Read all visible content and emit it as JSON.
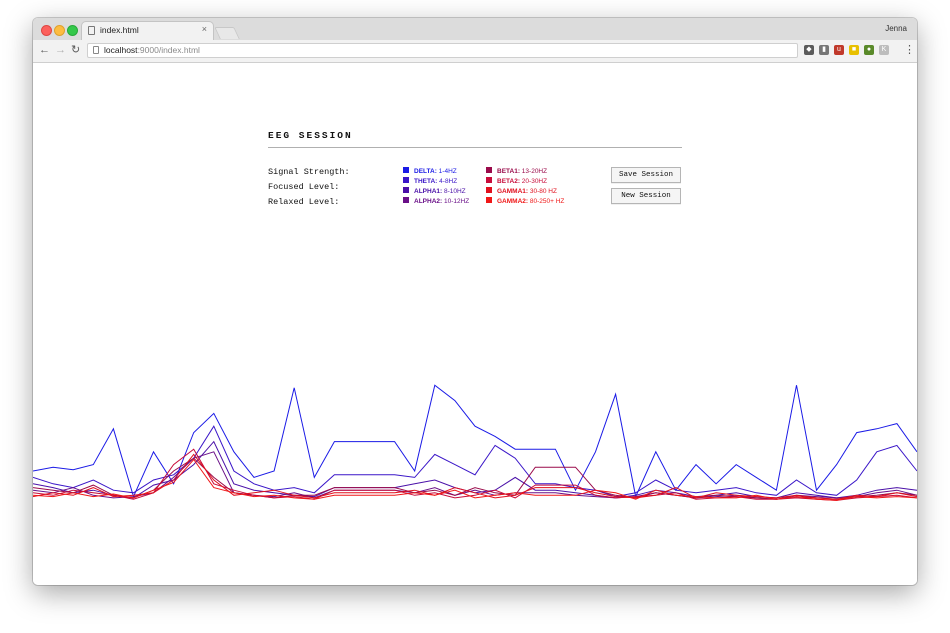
{
  "browser": {
    "tab_title": "index.html",
    "tab_close": "×",
    "profile_name": "Jenna",
    "url_host": "localhost",
    "url_path": ":9000/index.html",
    "extensions": [
      {
        "name": "evernote-icon",
        "color": "#5b5b5b",
        "glyph": "◆"
      },
      {
        "name": "bookmark-icon",
        "color": "#777777",
        "glyph": "▮"
      },
      {
        "name": "ublock-icon",
        "color": "#c0392b",
        "glyph": "u"
      },
      {
        "name": "yellow-extension-icon",
        "color": "#e8c000",
        "glyph": "■"
      },
      {
        "name": "pie-extension-icon",
        "color": "#5a8a2a",
        "glyph": "●"
      },
      {
        "name": "grey-extension-icon",
        "color": "#bdbdbd",
        "glyph": "K"
      }
    ]
  },
  "session": {
    "title": "EEG SESSION",
    "stats": [
      "Signal Strength:",
      "Focused Level:",
      "Relaxed Level:"
    ],
    "save_button": "Save Session",
    "new_button": "New Session"
  },
  "legend": [
    {
      "name": "DELTA:",
      "range": "1-4HZ",
      "color": "#1a1ae6"
    },
    {
      "name": "THETA:",
      "range": "4-8HZ",
      "color": "#3a16c8"
    },
    {
      "name": "ALPHA1:",
      "range": "8-10HZ",
      "color": "#4a10a8"
    },
    {
      "name": "ALPHA2:",
      "range": "10-12HZ",
      "color": "#6a1088"
    },
    {
      "name": "BETA1:",
      "range": "13-20HZ",
      "color": "#9a0a4a"
    },
    {
      "name": "BETA2:",
      "range": "20-30HZ",
      "color": "#c80c3a"
    },
    {
      "name": "GAMMA1:",
      "range": "30-80 HZ",
      "color": "#e0101e"
    },
    {
      "name": "GAMMA2:",
      "range": "80-250+ HZ",
      "color": "#f01818"
    }
  ],
  "chart_data": {
    "type": "line",
    "title": "",
    "xlabel": "",
    "ylabel": "",
    "grid": false,
    "legend": "none",
    "ylim": [
      0,
      100
    ],
    "x": [
      0,
      1,
      2,
      3,
      4,
      5,
      6,
      7,
      8,
      9,
      10,
      11,
      12,
      13,
      14,
      15,
      16,
      17,
      18,
      19,
      20,
      21,
      22,
      23,
      24,
      25,
      26,
      27,
      28,
      29,
      30,
      31,
      32,
      33,
      34,
      35,
      36,
      37,
      38,
      39,
      40,
      41,
      42,
      43,
      44
    ],
    "series": [
      {
        "name": "DELTA",
        "color": "#1a1ae6",
        "values": [
          25,
          28,
          26,
          30,
          58,
          5,
          40,
          15,
          55,
          70,
          40,
          20,
          25,
          90,
          20,
          48,
          48,
          48,
          48,
          25,
          92,
          80,
          60,
          52,
          42,
          42,
          42,
          10,
          40,
          85,
          5,
          40,
          10,
          30,
          15,
          30,
          20,
          10,
          92,
          10,
          30,
          55,
          58,
          62,
          40
        ]
      },
      {
        "name": "THETA",
        "color": "#3a16c8",
        "values": [
          20,
          15,
          12,
          18,
          10,
          8,
          18,
          22,
          35,
          60,
          25,
          15,
          10,
          12,
          8,
          22,
          22,
          22,
          22,
          20,
          38,
          30,
          22,
          45,
          35,
          15,
          15,
          12,
          10,
          5,
          8,
          18,
          10,
          8,
          10,
          12,
          8,
          6,
          18,
          8,
          6,
          18,
          40,
          45,
          25
        ]
      },
      {
        "name": "ALPHA1",
        "color": "#4a10a8",
        "values": [
          15,
          12,
          8,
          10,
          6,
          4,
          14,
          18,
          30,
          48,
          15,
          10,
          8,
          6,
          5,
          12,
          12,
          12,
          12,
          15,
          18,
          12,
          8,
          10,
          20,
          10,
          10,
          8,
          6,
          4,
          6,
          10,
          8,
          5,
          6,
          8,
          5,
          4,
          8,
          6,
          4,
          6,
          10,
          12,
          10
        ]
      },
      {
        "name": "ALPHA2",
        "color": "#6a1088",
        "values": [
          10,
          8,
          12,
          6,
          4,
          5,
          8,
          20,
          35,
          40,
          8,
          6,
          5,
          8,
          4,
          10,
          10,
          10,
          10,
          8,
          12,
          6,
          10,
          6,
          8,
          8,
          8,
          6,
          5,
          4,
          5,
          8,
          6,
          4,
          5,
          6,
          4,
          3,
          6,
          5,
          4,
          5,
          8,
          10,
          6
        ]
      },
      {
        "name": "BETA1",
        "color": "#9a0a4a",
        "values": [
          12,
          10,
          8,
          14,
          6,
          4,
          10,
          25,
          35,
          20,
          8,
          6,
          4,
          6,
          6,
          12,
          12,
          12,
          12,
          8,
          10,
          6,
          12,
          8,
          6,
          28,
          28,
          28,
          10,
          6,
          4,
          8,
          6,
          4,
          6,
          5,
          4,
          3,
          5,
          4,
          3,
          5,
          6,
          8,
          6
        ]
      },
      {
        "name": "BETA2",
        "color": "#c80c3a",
        "values": [
          8,
          6,
          10,
          8,
          6,
          3,
          8,
          30,
          42,
          15,
          10,
          6,
          4,
          5,
          3,
          10,
          10,
          10,
          10,
          6,
          8,
          4,
          6,
          10,
          4,
          14,
          14,
          14,
          6,
          4,
          5,
          6,
          8,
          3,
          4,
          5,
          3,
          3,
          4,
          3,
          2,
          4,
          5,
          6,
          4
        ]
      },
      {
        "name": "GAMMA1",
        "color": "#e0101e",
        "values": [
          5,
          8,
          6,
          12,
          5,
          6,
          8,
          18,
          38,
          18,
          6,
          8,
          10,
          6,
          4,
          8,
          8,
          8,
          8,
          10,
          6,
          12,
          8,
          4,
          6,
          12,
          12,
          12,
          8,
          5,
          4,
          6,
          12,
          4,
          8,
          6,
          5,
          4,
          6,
          4,
          3,
          6,
          5,
          8,
          5
        ]
      },
      {
        "name": "GAMMA2",
        "color": "#f01818",
        "values": [
          6,
          5,
          8,
          5,
          7,
          4,
          10,
          16,
          34,
          12,
          8,
          5,
          6,
          4,
          3,
          6,
          6,
          6,
          6,
          8,
          6,
          10,
          4,
          6,
          8,
          6,
          6,
          6,
          10,
          8,
          3,
          10,
          6,
          5,
          4,
          4,
          6,
          3,
          5,
          3,
          2,
          5,
          4,
          5,
          4
        ]
      }
    ]
  }
}
